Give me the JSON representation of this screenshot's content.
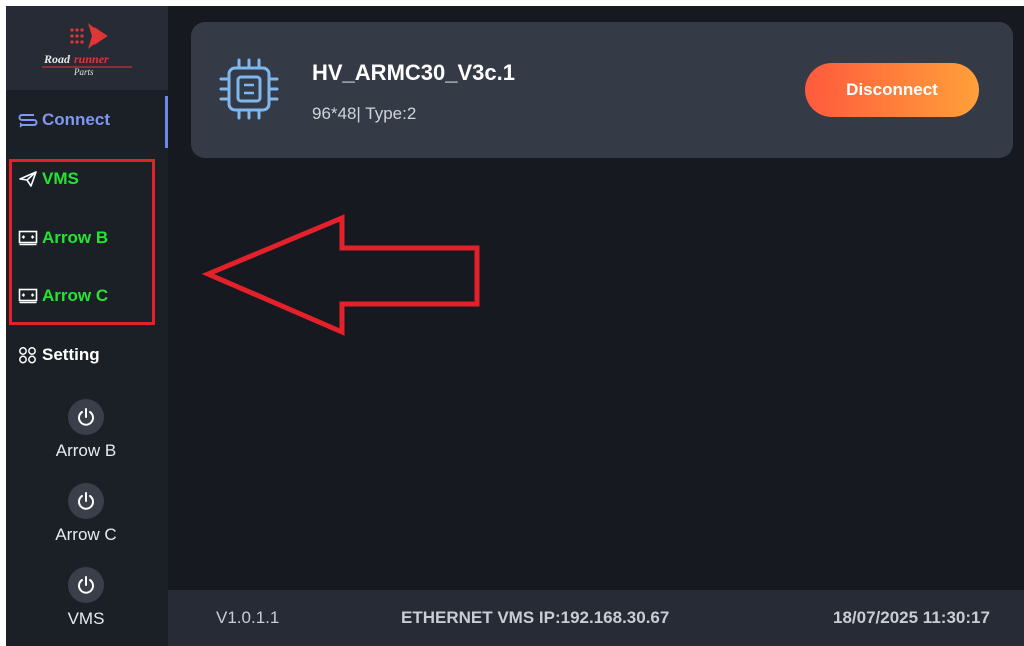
{
  "logo": {
    "line1": "Road",
    "line2": "runner",
    "line3": "Parts"
  },
  "sidebar": {
    "items": [
      {
        "label": "Connect",
        "icon": "connect-icon",
        "active": true,
        "color": "#7e97f0"
      },
      {
        "label": "VMS",
        "icon": "send-icon",
        "color": "#24e432"
      },
      {
        "label": "Arrow B",
        "icon": "panel-icon",
        "color": "#24e432"
      },
      {
        "label": "Arrow C",
        "icon": "panel-icon",
        "color": "#24e432"
      },
      {
        "label": "Setting",
        "icon": "grid-icon",
        "color": "#ffffff"
      }
    ],
    "power_buttons": [
      {
        "label": "Arrow B",
        "icon": "power-icon"
      },
      {
        "label": "Arrow C",
        "icon": "power-icon"
      },
      {
        "label": "VMS",
        "icon": "power-icon"
      }
    ]
  },
  "device": {
    "name": "HV_ARMC30_V3c.1",
    "info": "96*48| Type:2",
    "icon": "chip-icon",
    "disconnect_label": "Disconnect"
  },
  "status": {
    "version": "V1.0.1.1",
    "ip": "ETHERNET VMS IP:192.168.30.67",
    "datetime": "18/07/2025 11:30:17"
  },
  "annotation": {
    "color": "#e4212b",
    "arrow": "left-arrow-icon"
  },
  "colors": {
    "background": "#16191f",
    "sidebar": "#1b1f26",
    "card": "#353b46",
    "accent_green": "#24e432",
    "accent_blue": "#7e97f0",
    "disconnect_gradient_start": "#ff5a3c",
    "disconnect_gradient_end": "#ffa03a"
  }
}
